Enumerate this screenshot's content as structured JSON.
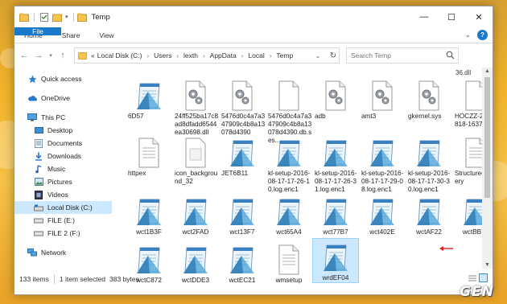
{
  "window": {
    "title": "Temp",
    "controls": {
      "minimize": "—",
      "maximize": "☐",
      "close": "✕"
    }
  },
  "ribbon": {
    "tabs": [
      "File",
      "Home",
      "Share",
      "View"
    ],
    "expand_icon": "chevron-down-icon",
    "help_label": "?"
  },
  "address_bar": {
    "prefix": "«",
    "crumbs": [
      "Local Disk (C:)",
      "Users",
      "lexth",
      "AppData",
      "Local",
      "Temp"
    ]
  },
  "search": {
    "placeholder": "Search Temp"
  },
  "sidebar": {
    "items": [
      {
        "label": "Quick access",
        "icon": "star-icon"
      },
      {
        "label": "OneDrive",
        "icon": "cloud-icon"
      },
      {
        "label": "This PC",
        "icon": "computer-icon"
      },
      {
        "label": "Desktop",
        "icon": "desktop-icon"
      },
      {
        "label": "Documents",
        "icon": "documents-icon"
      },
      {
        "label": "Downloads",
        "icon": "download-icon"
      },
      {
        "label": "Music",
        "icon": "music-icon"
      },
      {
        "label": "Pictures",
        "icon": "pictures-icon"
      },
      {
        "label": "Videos",
        "icon": "videos-icon"
      },
      {
        "label": "Local Disk (C:)",
        "icon": "drive-icon",
        "selected": true
      },
      {
        "label": "FILE (E:)",
        "icon": "drive-icon"
      },
      {
        "label": "FILE 2 (F:)",
        "icon": "drive-icon"
      },
      {
        "label": "Network",
        "icon": "network-icon"
      }
    ]
  },
  "files": {
    "partial_top": "36.dll",
    "row1": [
      {
        "name": "6D57",
        "icon": "notepad-icon"
      },
      {
        "name": "24ff525ba17c8ad8dfadd6544ea30698.dll",
        "icon": "gear-file-icon"
      },
      {
        "name": "5476d0c4a7a347909c4b8a13078d4390",
        "icon": "gear-file-icon"
      },
      {
        "name": "5476d0c4a7a347909c4b8a13078d4390.db.ses...",
        "icon": "blank-file-icon"
      },
      {
        "name": "adb",
        "icon": "gear-file-icon"
      },
      {
        "name": "amt3",
        "icon": "gear-file-icon"
      },
      {
        "name": "gkernel.sys",
        "icon": "gear-file-icon"
      },
      {
        "name": "HOCZZ-20160818-1637",
        "icon": "blank-file-icon"
      }
    ],
    "row2": [
      {
        "name": "httpex",
        "icon": "text-file-icon"
      },
      {
        "name": "icon_background_32",
        "icon": "image-file-icon"
      },
      {
        "name": "JET6B11",
        "icon": "notepad-icon"
      },
      {
        "name": "kl-setup-2016-08-17-17-26-10.log.enc1",
        "icon": "notepad-icon"
      },
      {
        "name": "kl-setup-2016-08-17-17-26-31.log.enc1",
        "icon": "notepad-icon"
      },
      {
        "name": "kl-setup-2016-08-17-17-29-08.log.enc1",
        "icon": "notepad-icon"
      },
      {
        "name": "kl-setup-2016-08-17-17-30-30.log.enc1",
        "icon": "notepad-icon"
      },
      {
        "name": "Structured Query",
        "icon": "text-file-icon"
      }
    ],
    "row3": [
      {
        "name": "wct1B3F",
        "icon": "notepad-icon"
      },
      {
        "name": "wct2FAD",
        "icon": "notepad-icon"
      },
      {
        "name": "wct13F7",
        "icon": "notepad-icon"
      },
      {
        "name": "wct65A4",
        "icon": "notepad-icon"
      },
      {
        "name": "wct77B7",
        "icon": "notepad-icon"
      },
      {
        "name": "wct402E",
        "icon": "notepad-icon"
      },
      {
        "name": "wctAF22",
        "icon": "notepad-icon"
      },
      {
        "name": "wctBB77",
        "icon": "notepad-icon"
      }
    ],
    "row4": [
      {
        "name": "wctC872",
        "icon": "notepad-icon"
      },
      {
        "name": "wctDDE3",
        "icon": "notepad-icon"
      },
      {
        "name": "wctEC21",
        "icon": "notepad-icon"
      },
      {
        "name": "wmsetup",
        "icon": "text-file-icon"
      },
      {
        "name": "wrdEF04",
        "icon": "notepad-icon",
        "selected": true
      }
    ]
  },
  "status": {
    "item_count": "133 items",
    "selection": "1 item selected",
    "size": "383 bytes"
  },
  "colors": {
    "file_tab": "#1979ca",
    "selection": "#cce8ff",
    "annotation_arrow": "#e02020"
  },
  "watermark": "GEN"
}
